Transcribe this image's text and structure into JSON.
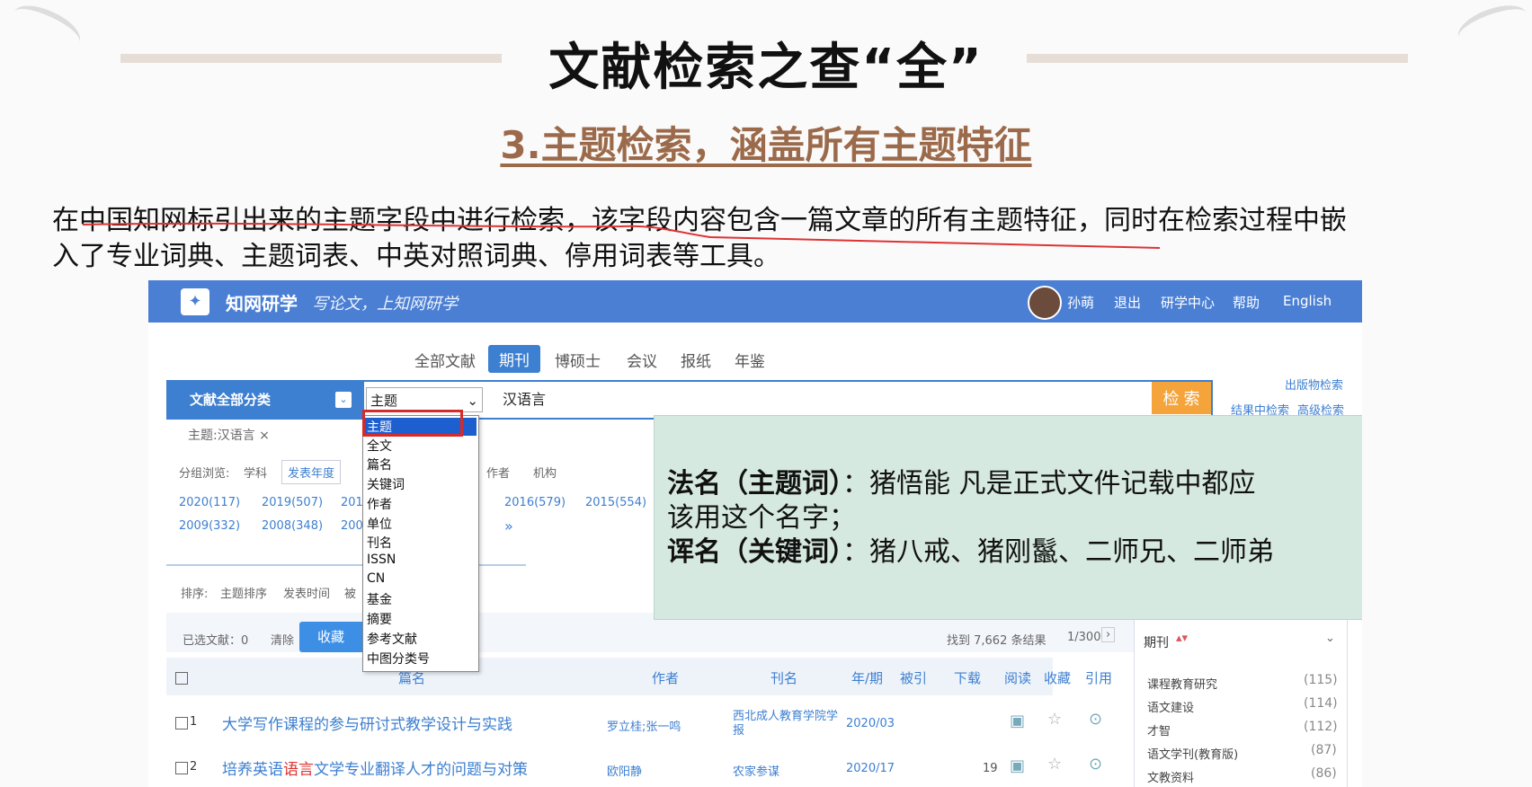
{
  "slide": {
    "title": "文献检索之查“全”",
    "subtitle": "3.主题检索，涵盖所有主题特征",
    "paragraph_line1": "在中国知网标引出来的主题字段中进行检索，该字段内容包含一篇文章的所有主题特征，同时在检索过程中嵌",
    "paragraph_line2": "入了专业词典、主题词表、中英对照词典、停用词表等工具。"
  },
  "site": {
    "brand": "知网研学",
    "slogan": "写论文，上知网研学",
    "user": "孙萌",
    "nav": [
      "退出",
      "研学中心",
      "帮助",
      "English"
    ],
    "tabs": [
      "全部文献",
      "期刊",
      "博硕士",
      "会议",
      "报纸",
      "年鉴"
    ],
    "category": "文献全部分类",
    "field_selected": "主题",
    "query": "汉语言",
    "search_button": "检 索",
    "links": [
      "出版物检索",
      "结果中检索",
      "高级检索"
    ],
    "filter_tag": "主题:汉语言 ×",
    "group_label": "分组浏览:",
    "group_tabs": [
      "学科",
      "发表年度",
      "作者",
      "机构"
    ],
    "years": [
      "2020(117)",
      "2019(507)",
      "201",
      "2016(579)",
      "2015(554)",
      "2009(332)",
      "2008(348)",
      "200",
      "»"
    ],
    "sort_label": "排序:",
    "sort_opts": [
      "主题排序",
      "发表时间",
      "被"
    ],
    "selected_label": "已选文献：0",
    "clear": "清除",
    "collect": "收藏",
    "result_count": "找到 7,662 条结果",
    "page": "1/300",
    "columns": [
      "篇名",
      "作者",
      "刊名",
      "年/期",
      "被引",
      "下载",
      "阅读",
      "收藏",
      "引用"
    ],
    "rows": [
      {
        "no": "1",
        "title": "大学写作课程的参与研讨式教学设计与实践",
        "author": "罗立桂;张一鸣",
        "journal": "西北成人教育学院学报",
        "issue": "2020/03",
        "cited": "",
        "downloads": ""
      },
      {
        "no": "2",
        "title_pre": "培养英语",
        "title_hl": "语言",
        "title_post": "文学专业翻译人才的问题与对策",
        "author": "欧阳静",
        "journal": "农家参谋",
        "issue": "2020/17",
        "cited": "",
        "downloads": "19"
      }
    ],
    "side_title": "期刊",
    "side_items": [
      {
        "name": "课程教育研究",
        "count": "(115)"
      },
      {
        "name": "语文建设",
        "count": "(114)"
      },
      {
        "name": "才智",
        "count": "(112)"
      },
      {
        "name": "语文学刊(教育版)",
        "count": "(87)"
      },
      {
        "name": "文教资料",
        "count": "(86)"
      }
    ]
  },
  "dropdown_options": [
    "主题",
    "全文",
    "篇名",
    "关键词",
    "作者",
    "单位",
    "刊名",
    "ISSN",
    "CN",
    "基金",
    "摘要",
    "参考文献",
    "中图分类号"
  ],
  "overlay": {
    "line1_bold": "法名（主题词）",
    "line1_rest": "：猪悟能 凡是正式文件记载中都应",
    "line2": "该用这个名字；",
    "line3_bold": "诨名（关键词）",
    "line3_rest": "：猪八戒、猪刚鬣、二师兄、二师弟"
  }
}
